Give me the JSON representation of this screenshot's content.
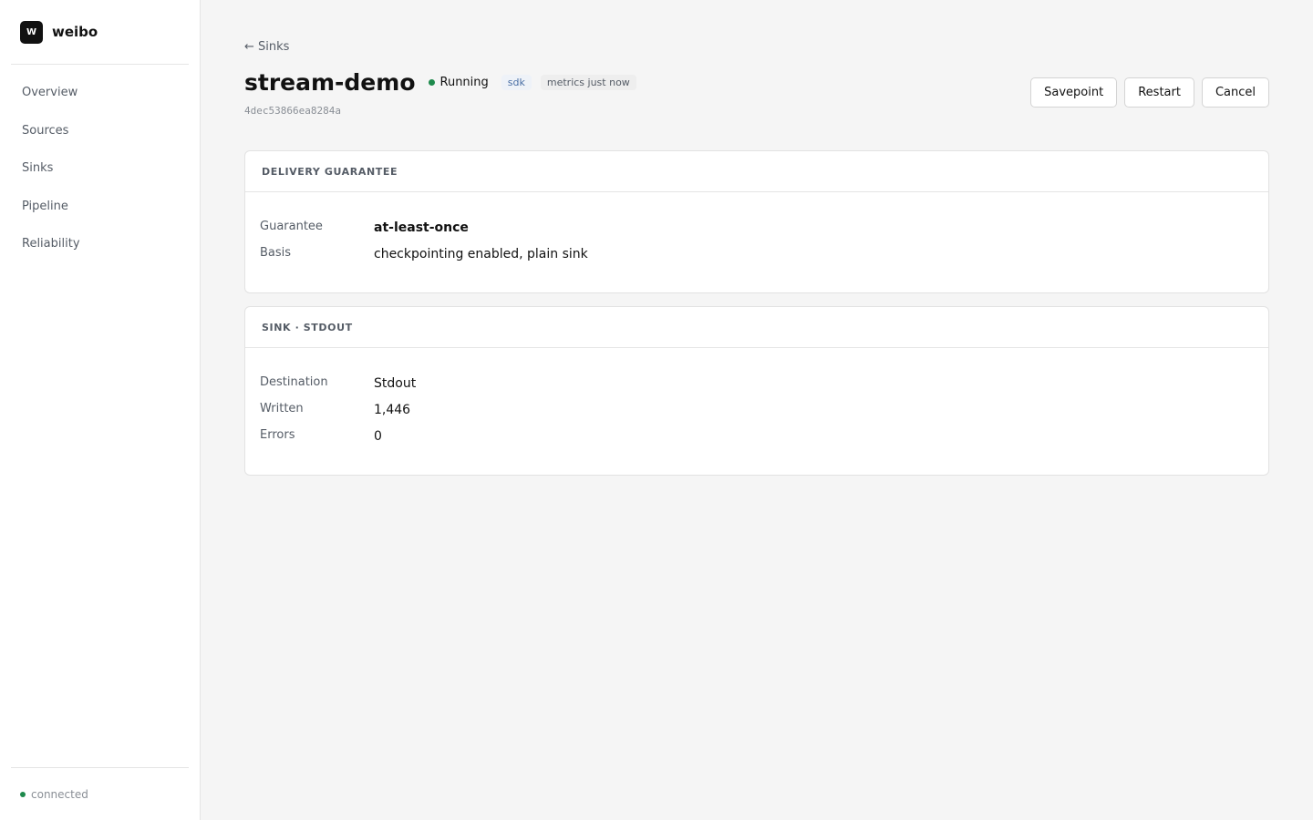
{
  "app": {
    "logo_letter": "W",
    "name": "weibo"
  },
  "sidebar": {
    "items": [
      {
        "label": "Overview"
      },
      {
        "label": "Sources"
      },
      {
        "label": "Sinks"
      },
      {
        "label": "Pipeline"
      },
      {
        "label": "Reliability"
      }
    ],
    "footer_status": "connected"
  },
  "header": {
    "back_label": "← Sinks",
    "title": "stream-demo",
    "status": "Running",
    "tags": [
      "sdk",
      "metrics just now"
    ],
    "job_id": "4dec53866ea8284a",
    "actions": {
      "savepoint": "Savepoint",
      "restart": "Restart",
      "cancel": "Cancel"
    }
  },
  "delivery": {
    "title": "DELIVERY GUARANTEE",
    "rows": [
      {
        "key": "Guarantee",
        "value": "at-least-once"
      },
      {
        "key": "Basis",
        "value": "checkpointing enabled, plain sink"
      }
    ]
  },
  "sink": {
    "title": "SINK · STDOUT",
    "rows": [
      {
        "key": "Destination",
        "value": "Stdout"
      },
      {
        "key": "Written",
        "value": "1,446"
      },
      {
        "key": "Errors",
        "value": "0"
      }
    ]
  },
  "colors": {
    "status_running": "#1e8a4c",
    "connected": "#1e8a4c"
  }
}
